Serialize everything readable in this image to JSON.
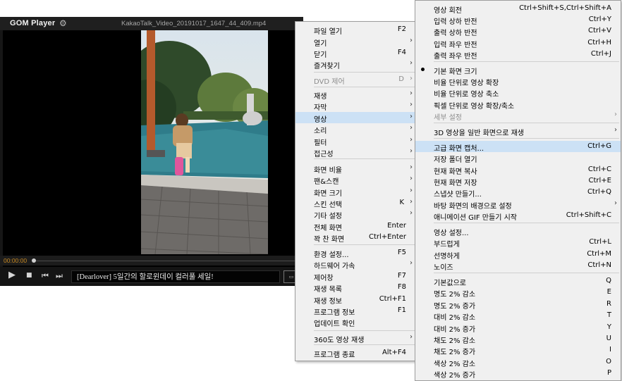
{
  "player": {
    "logo": "GOM Player",
    "filename": "KakaoTalk_Video_20191017_1647_44_409.mp4",
    "time": "00:00:00",
    "ad_text": "[Dearlover] 5일간의 할로윈데이 컬러풀 세일!",
    "progress_fraction": 0.0
  },
  "menu_main": {
    "items": [
      {
        "label": "파일 열기",
        "shortcut": "F2"
      },
      {
        "label": "열기",
        "shortcut": "",
        "submenu": true
      },
      {
        "label": "닫기",
        "shortcut": "F4"
      },
      {
        "label": "즐겨찾기",
        "shortcut": "",
        "submenu": true
      },
      {
        "label": "DVD 제어",
        "shortcut": "D",
        "submenu": true,
        "disabled": true
      },
      {
        "label": "재생",
        "shortcut": "",
        "submenu": true
      },
      {
        "label": "자막",
        "shortcut": "",
        "submenu": true
      },
      {
        "label": "영상",
        "shortcut": "",
        "submenu": true,
        "highlighted": true
      },
      {
        "label": "소리",
        "shortcut": "",
        "submenu": true
      },
      {
        "label": "필터",
        "shortcut": "",
        "submenu": true
      },
      {
        "label": "접근성",
        "shortcut": "",
        "submenu": true
      },
      {
        "label": "화면 비율",
        "shortcut": "",
        "submenu": true
      },
      {
        "label": "팬&스캔",
        "shortcut": "",
        "submenu": true
      },
      {
        "label": "화면 크기",
        "shortcut": "",
        "submenu": true
      },
      {
        "label": "스킨 선택",
        "shortcut": "K",
        "submenu": true
      },
      {
        "label": "기타 설정",
        "shortcut": "",
        "submenu": true
      },
      {
        "label": "전체 화면",
        "shortcut": "Enter"
      },
      {
        "label": "꽉 찬 화면",
        "shortcut": "Ctrl+Enter"
      },
      {
        "label": "환경 설정...",
        "shortcut": "F5"
      },
      {
        "label": "하드웨어 가속",
        "shortcut": "",
        "submenu": true
      },
      {
        "label": "제어창",
        "shortcut": "F7"
      },
      {
        "label": "재생 목록",
        "shortcut": "F8"
      },
      {
        "label": "재생 정보",
        "shortcut": "Ctrl+F1"
      },
      {
        "label": "프로그램 정보",
        "shortcut": "F1"
      },
      {
        "label": "업데이트 확인",
        "shortcut": ""
      },
      {
        "label": "360도 영상 재생",
        "shortcut": "",
        "submenu": true
      },
      {
        "label": "프로그램 종료",
        "shortcut": "Alt+F4"
      }
    ]
  },
  "menu_video": {
    "items": [
      {
        "label": "영상 회전",
        "shortcut": "Ctrl+Shift+S,Ctrl+Shift+A"
      },
      {
        "label": "입력 상하 반전",
        "shortcut": "Ctrl+Y"
      },
      {
        "label": "출력 상하 반전",
        "shortcut": "Ctrl+V"
      },
      {
        "label": "입력 좌우 반전",
        "shortcut": "Ctrl+H"
      },
      {
        "label": "출력 좌우 반전",
        "shortcut": "Ctrl+J"
      },
      {
        "label": "기본 화면 크기",
        "shortcut": "",
        "checked": true
      },
      {
        "label": "비율 단위로 영상 확장",
        "shortcut": ""
      },
      {
        "label": "비율 단위로 영상 축소",
        "shortcut": ""
      },
      {
        "label": "픽셀 단위로 영상 확장/축소",
        "shortcut": ""
      },
      {
        "label": "세부 설정",
        "shortcut": "",
        "submenu": true,
        "disabled": true
      },
      {
        "label": "3D 영상을 일반 화면으로 재생",
        "shortcut": "",
        "submenu": true
      },
      {
        "label": "고급 화면 캡처...",
        "shortcut": "Ctrl+G",
        "highlighted": true
      },
      {
        "label": "저장 폴더 열기",
        "shortcut": ""
      },
      {
        "label": "현재 화면 복사",
        "shortcut": "Ctrl+C"
      },
      {
        "label": "현재 화면 저장",
        "shortcut": "Ctrl+E"
      },
      {
        "label": "스냅샷 만들기...",
        "shortcut": "Ctrl+Q"
      },
      {
        "label": "바탕 화면의 배경으로 설정",
        "shortcut": "",
        "submenu": true
      },
      {
        "label": "애니메이션 GIF 만들기 시작",
        "shortcut": "Ctrl+Shift+C"
      },
      {
        "label": "영상 설정...",
        "shortcut": ""
      },
      {
        "label": "부드럽게",
        "shortcut": "Ctrl+L"
      },
      {
        "label": "선명하게",
        "shortcut": "Ctrl+M"
      },
      {
        "label": "노이즈",
        "shortcut": "Ctrl+N"
      },
      {
        "label": "기본값으로",
        "shortcut": "Q"
      },
      {
        "label": "명도   2% 감소",
        "shortcut": "E"
      },
      {
        "label": "명도   2% 증가",
        "shortcut": "R"
      },
      {
        "label": "대비   2% 감소",
        "shortcut": "T"
      },
      {
        "label": "대비   2% 증가",
        "shortcut": "Y"
      },
      {
        "label": "채도   2% 감소",
        "shortcut": "U"
      },
      {
        "label": "채도   2% 증가",
        "shortcut": "I"
      },
      {
        "label": "색상   2% 감소",
        "shortcut": "O"
      },
      {
        "label": "색상   2% 증가",
        "shortcut": "P"
      }
    ]
  }
}
